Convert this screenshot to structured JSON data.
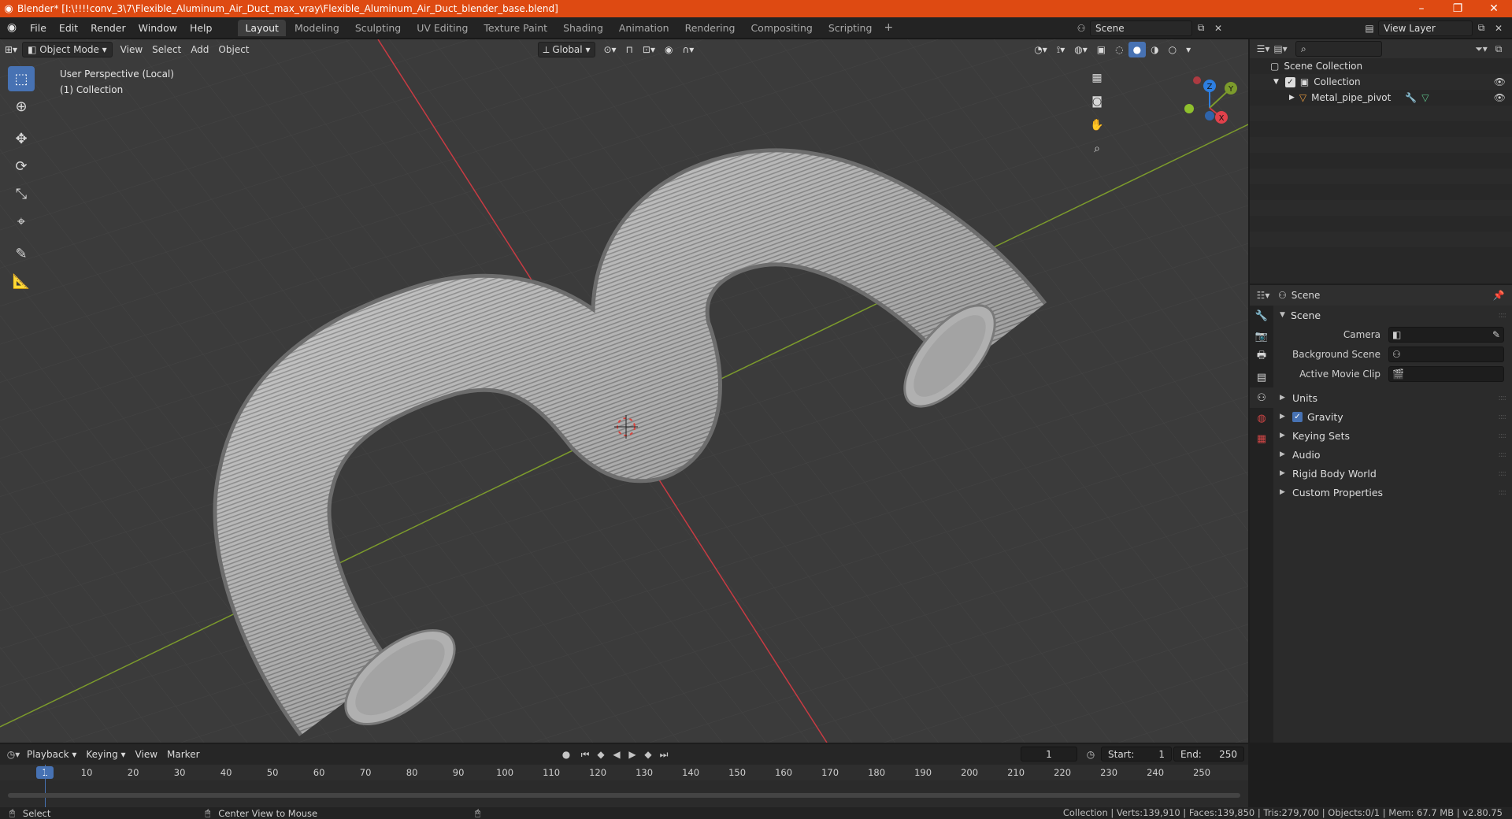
{
  "window": {
    "title": "Blender* [I:\\!!!!conv_3\\7\\Flexible_Aluminum_Air_Duct_max_vray\\Flexible_Aluminum_Air_Duct_blender_base.blend]",
    "minimize": "–",
    "maximize": "❐",
    "close": "✕"
  },
  "menu": [
    "File",
    "Edit",
    "Render",
    "Window",
    "Help"
  ],
  "workspaces": [
    "Layout",
    "Modeling",
    "Sculpting",
    "UV Editing",
    "Texture Paint",
    "Shading",
    "Animation",
    "Rendering",
    "Compositing",
    "Scripting"
  ],
  "workspace_add": "+",
  "scene": {
    "name": "Scene",
    "view_layer": "View Layer"
  },
  "viewport": {
    "mode": "Object Mode",
    "menus": [
      "View",
      "Select",
      "Add",
      "Object"
    ],
    "transform_orientation": "Global",
    "info_line1": "User Perspective (Local)",
    "info_line2": "(1) Collection",
    "gizmo_labels": {
      "x": "X",
      "y": "Y",
      "z": "Z"
    }
  },
  "outliner": {
    "root": "Scene Collection",
    "collection": "Collection",
    "object": "Metal_pipe_pivot"
  },
  "properties": {
    "context": "Scene",
    "panel": "Scene",
    "rows": [
      {
        "label": "Camera"
      },
      {
        "label": "Background Scene"
      },
      {
        "label": "Active Movie Clip"
      }
    ],
    "subpanels": [
      "Units",
      "Gravity",
      "Keying Sets",
      "Audio",
      "Rigid Body World",
      "Custom Properties"
    ]
  },
  "timeline": {
    "menus": [
      "Playback",
      "Keying",
      "View",
      "Marker"
    ],
    "current_frame": "1",
    "start_label": "Start:",
    "start": "1",
    "end_label": "End:",
    "end": "250",
    "ruler": [
      "1",
      "10",
      "20",
      "30",
      "40",
      "50",
      "60",
      "70",
      "80",
      "90",
      "100",
      "110",
      "120",
      "130",
      "140",
      "150",
      "160",
      "170",
      "180",
      "190",
      "200",
      "210",
      "220",
      "230",
      "240",
      "250"
    ]
  },
  "status": {
    "left": "Select",
    "middle": "Center View to Mouse",
    "stats": "Collection | Verts:139,910 | Faces:139,850 | Tris:279,700 | Objects:0/1 | Mem: 67.7 MB | v2.80.75"
  },
  "colors": {
    "accent": "#4772b3",
    "titlebar": "#de4a12",
    "x_axis": "#c93b43",
    "y_axis": "#7c9b2c",
    "z_axis": "#2d7ee0"
  }
}
